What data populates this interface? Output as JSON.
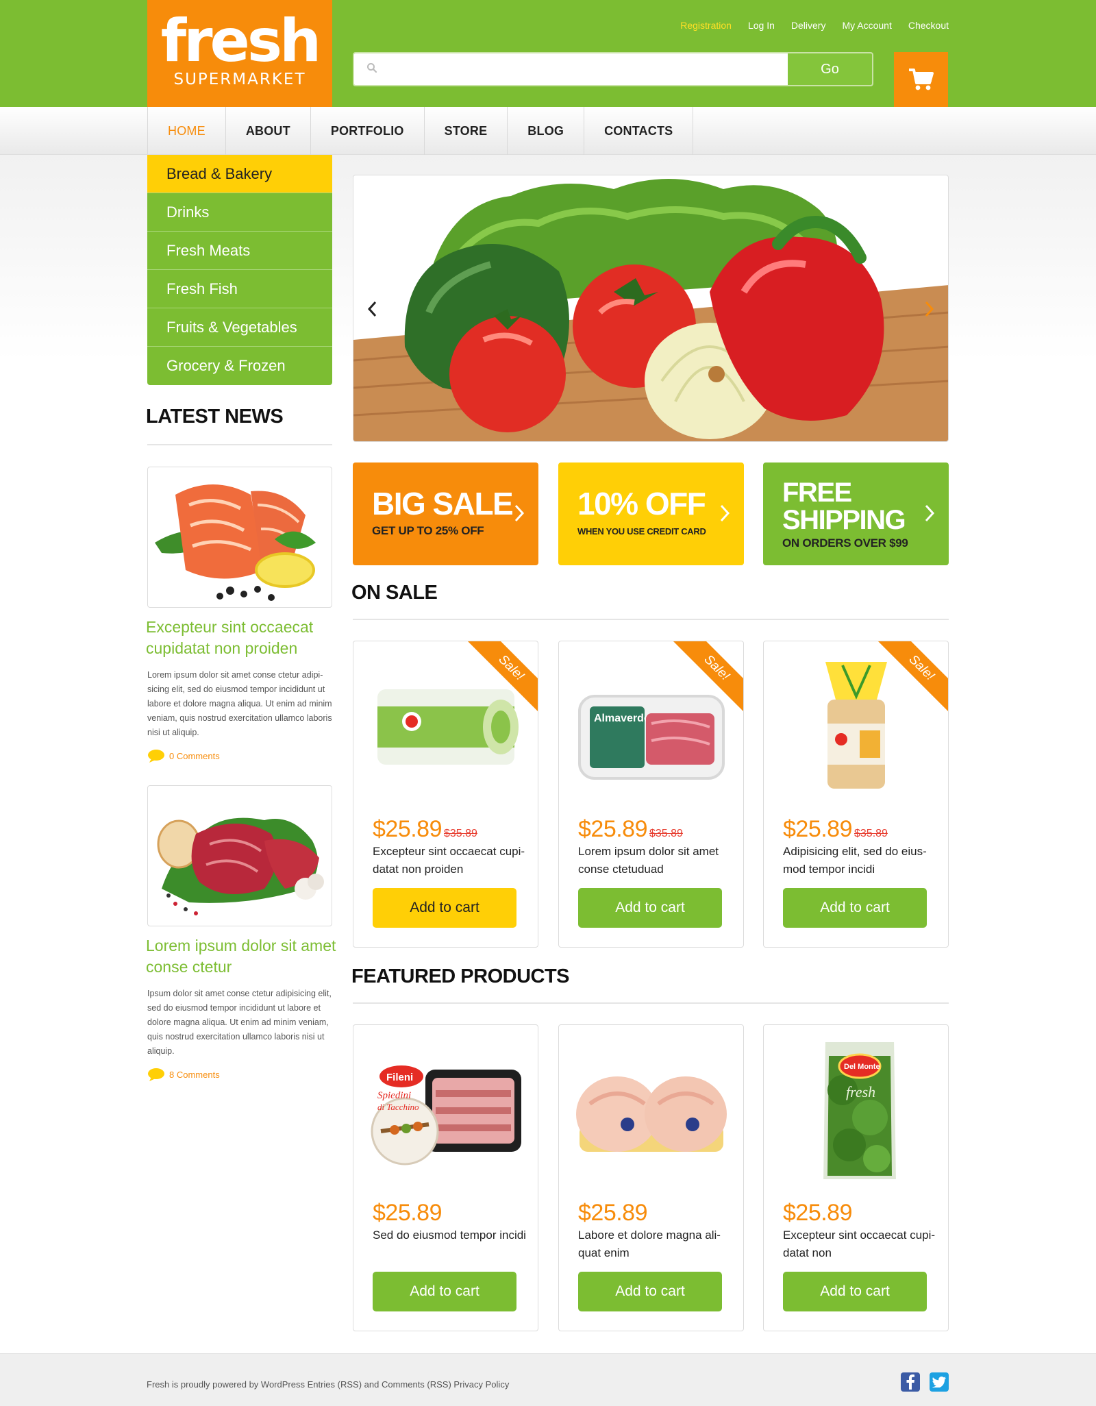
{
  "logo": {
    "word": "fresh",
    "sub": "SUPERMARKET"
  },
  "toplinks": [
    {
      "label": "Registration"
    },
    {
      "label": "Log In"
    },
    {
      "label": "Delivery"
    },
    {
      "label": "My Account"
    },
    {
      "label": "Checkout"
    }
  ],
  "search": {
    "placeholder": "",
    "value": "",
    "button": "Go"
  },
  "nav": [
    "HOME",
    "ABOUT",
    "PORTFOLIO",
    "STORE",
    "BLOG",
    "CONTACTS"
  ],
  "categories": [
    "Bread & Bakery",
    "Drinks",
    "Fresh Meats",
    "Fresh Fish",
    "Fruits & Vegetables",
    "Grocery & Frozen"
  ],
  "latest_news": {
    "title": "LATEST NEWS",
    "items": [
      {
        "headline": "Excepteur sint occaecat cupidatat non proiden",
        "body": "Lorem ipsum dolor sit amet conse ctetur adipi-sicing elit, sed do eiusmod tempor incididunt ut labore et dolore magna aliqua. Ut enim ad minim veniam, quis nostrud exercitation ullamco laboris nisi ut aliquip.",
        "comments": "0 Comments"
      },
      {
        "headline": "Lorem ipsum dolor sit amet conse ctetur",
        "body": "Ipsum dolor sit amet conse ctetur adipisicing elit, sed do eiusmod tempor incididunt ut labore et dolore magna aliqua. Ut enim ad minim veniam, quis nostrud exercitation ullamco laboris nisi ut aliquip.",
        "comments": "8 Comments"
      }
    ]
  },
  "promos": [
    {
      "big": "BIG SALE",
      "small": "GET UP TO 25% OFF"
    },
    {
      "big": "10% OFF",
      "small": "WHEN YOU USE CREDIT CARD"
    },
    {
      "big1": "FREE",
      "big2": "SHIPPING",
      "small": "ON ORDERS OVER $99"
    }
  ],
  "on_sale": {
    "title": "ON SALE",
    "ribbon": "Sale!",
    "products": [
      {
        "price": "$25.89",
        "old_price": "$35.89",
        "name": "Excepteur sint occaecat cupi-datat non proiden",
        "button": "Add to cart"
      },
      {
        "price": "$25.89",
        "old_price": "$35.89",
        "name": "Lorem ipsum dolor sit amet conse ctetuduad",
        "button": "Add to cart"
      },
      {
        "price": "$25.89",
        "old_price": "$35.89",
        "name": "Adipisicing elit, sed do eius-mod tempor incidi",
        "button": "Add to cart"
      }
    ]
  },
  "featured": {
    "title": "FEATURED PRODUCTS",
    "products": [
      {
        "price": "$25.89",
        "name": "Sed do eiusmod tempor incidi",
        "button": "Add to cart"
      },
      {
        "price": "$25.89",
        "name": "Labore et dolore magna ali-quat enim",
        "button": "Add to cart"
      },
      {
        "price": "$25.89",
        "name": "Excepteur sint occaecat cupi-datat non",
        "button": "Add to cart"
      }
    ]
  },
  "product_labels": {
    "almaverde": "Almaverde",
    "fileni": "Fileni",
    "spiedini": "Spiedini",
    "di_tacchino": "di Tacchino",
    "del_monte": "Del Monte",
    "fresh": "fresh"
  },
  "footer": {
    "text": "Fresh is proudly powered by WordPress Entries (RSS) and Comments (RSS) Privacy Policy"
  },
  "colors": {
    "green": "#7cbd32",
    "orange": "#f78c0b",
    "yellow": "#ffcf06",
    "accent_link": "#ffe025"
  },
  "icons": [
    "search-icon",
    "cart-icon",
    "chevron-left-icon",
    "chevron-right-icon",
    "comment-icon",
    "facebook-icon",
    "twitter-icon"
  ]
}
